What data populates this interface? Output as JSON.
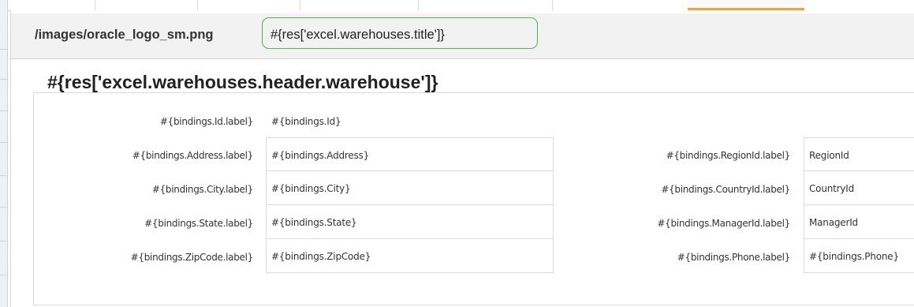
{
  "header": {
    "logo_src": "/images/oracle_logo_sm.png",
    "title": "#{res['excel.warehouses.title']}"
  },
  "section": {
    "header": "#{res['excel.warehouses.header.warehouse']}"
  },
  "form": {
    "id": {
      "label": "#{bindings.Id.label}",
      "value": "#{bindings.Id}"
    },
    "left_fields": [
      {
        "label": "#{bindings.Address.label}",
        "value": "#{bindings.Address}"
      },
      {
        "label": "#{bindings.City.label}",
        "value": "#{bindings.City}"
      },
      {
        "label": "#{bindings.State.label}",
        "value": "#{bindings.State}"
      },
      {
        "label": "#{bindings.ZipCode.label}",
        "value": "#{bindings.ZipCode}"
      }
    ],
    "right_fields": [
      {
        "label": "#{bindings.RegionId.label}",
        "value": "RegionId"
      },
      {
        "label": "#{bindings.CountryId.label}",
        "value": "CountryId"
      },
      {
        "label": "#{bindings.ManagerId.label}",
        "value": "ManagerId"
      },
      {
        "label": "#{bindings.Phone.label}",
        "value": "#{bindings.Phone}"
      }
    ]
  },
  "colors": {
    "title_highlight": "#43c043",
    "active_column": "#f2a33a",
    "title_bar_bg": "#f2f2f2"
  }
}
